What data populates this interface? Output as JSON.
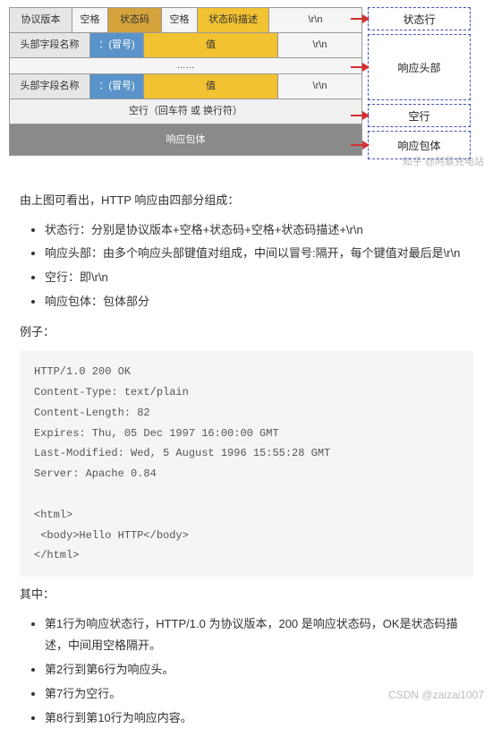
{
  "diagram": {
    "row1": {
      "c1": "协议版本",
      "c2": "空格",
      "c3": "状态码",
      "c4": "空格",
      "c5": "状态码描述",
      "c6": "\\r\\n"
    },
    "row2": {
      "c1": "头部字段名称",
      "c2": "：(冒号)",
      "c3": "值",
      "c4": "\\r\\n"
    },
    "dots": "……",
    "row3": {
      "c1": "头部字段名称",
      "c2": "：(冒号)",
      "c3": "值",
      "c4": "\\r\\n"
    },
    "empty": "空行（回车符 或 换行符）",
    "body": "响应包体",
    "labels": {
      "l1": "状态行",
      "l2": "响应头部",
      "l3": "空行",
      "l4": "响应包体"
    },
    "watermark": "知乎 @阿蔡充电站"
  },
  "intro": "由上图可看出，HTTP 响应由四部分组成：",
  "parts": [
    "状态行：分别是协议版本+空格+状态码+空格+状态码描述+\\r\\n",
    "响应头部：由多个响应头部键值对组成，中间以冒号:隔开，每个键值对最后是\\r\\n",
    "空行：即\\r\\n",
    "响应包体：包体部分"
  ],
  "example_label": "例子：",
  "code_lines": [
    "HTTP/1.0 200 OK",
    "Content-Type: text/plain",
    "Content-Length: 82",
    "Expires: Thu, 05 Dec 1997 16:00:00 GMT",
    "Last-Modified: Wed, 5 August 1996 15:55:28 GMT",
    "Server: Apache 0.84",
    "",
    "<html>",
    " <body>Hello HTTP</body>",
    "</html>"
  ],
  "wherein": "其中：",
  "explain": [
    "第1行为响应状态行，HTTP/1.0 为协议版本，200 是响应状态码，OK是状态码描述，中间用空格隔开。",
    "第2行到第6行为响应头。",
    "第7行为空行。",
    "第8行到第10行为响应内容。"
  ],
  "footer": "CSDN @zaizai1007"
}
